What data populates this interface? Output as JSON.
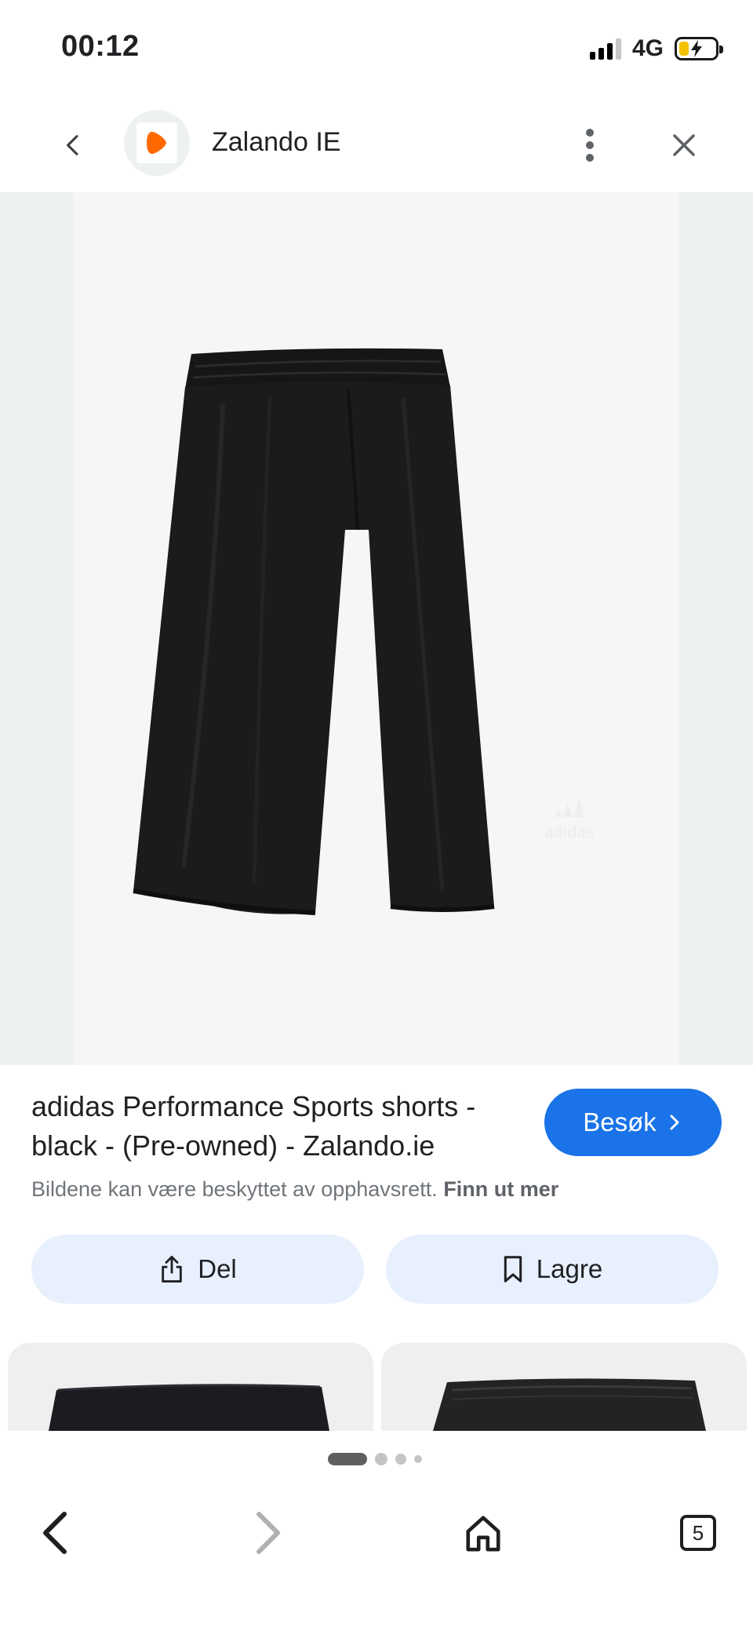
{
  "status_bar": {
    "time": "00:12",
    "network": "4G",
    "battery_level": 0.35,
    "battery_color": "#f2c200"
  },
  "header": {
    "back_icon": "chevron-left-icon",
    "site_logo_icon": "zalando-logo-icon",
    "site_logo_color": "#ff6900",
    "site_title": "Zalando IE",
    "more_icon": "more-vert-icon",
    "close_icon": "close-icon"
  },
  "product": {
    "image_icon": "black-sports-shorts-image",
    "logo_text": "adidas"
  },
  "result": {
    "title": "adidas Performance Sports shorts - black - (Pre-owned) - Zalando.ie",
    "visit_label": "Besøk",
    "visit_icon": "chevron-right-icon",
    "copyright_text": "Bildene kan være beskyttet av opphavsrett.",
    "learn_more": "Finn ut mer"
  },
  "actions": {
    "share_label": "Del",
    "share_icon": "share-icon",
    "save_label": "Lagre",
    "save_icon": "bookmark-icon"
  },
  "related": {
    "thumbnails": [
      "related-shorts-thumbnail-1",
      "related-shorts-thumbnail-2"
    ]
  },
  "bottom_nav": {
    "back_icon": "arrow-back-icon",
    "forward_icon": "arrow-forward-icon",
    "home_icon": "home-icon",
    "tabs_count": "5",
    "active_page": 1,
    "page_count": 4
  },
  "colors": {
    "accent": "#1a73e8",
    "button_bg": "#e8f0fe",
    "image_bg": "#f6f6f6"
  }
}
